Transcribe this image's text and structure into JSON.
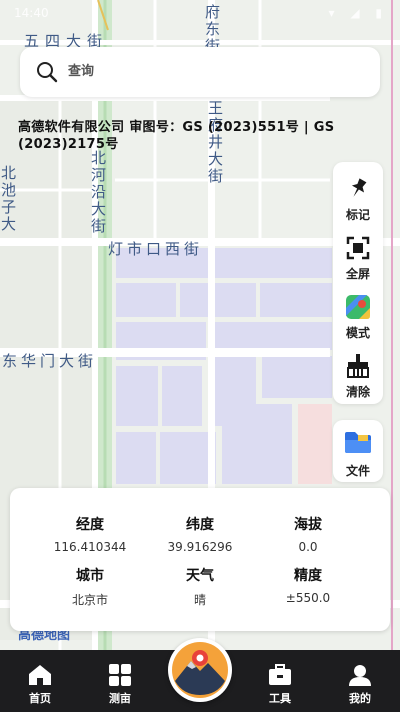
{
  "status_bar": {
    "time": "14:40",
    "system_icons": "▾ ◢ ▮"
  },
  "map": {
    "streets": [
      {
        "id": "wangfujing_east",
        "text": "府东街"
      },
      {
        "id": "wusi",
        "text": "五四大街"
      },
      {
        "id": "wangfujing",
        "text": "王府井大街"
      },
      {
        "id": "beiheyan",
        "text": "北河沿大街"
      },
      {
        "id": "dengshikou",
        "text": "灯市口西街"
      },
      {
        "id": "donghuamen",
        "text": "东华门大街"
      },
      {
        "id": "beichizi",
        "text": "北池子大"
      }
    ],
    "colors": {
      "park": "#cfe8cc",
      "block": "#dcdcf2",
      "hospital": "#f6dede",
      "road": "#ffffff"
    }
  },
  "search": {
    "label": "查询",
    "icon": "search-icon"
  },
  "approval_text": "高德软件有限公司 审图号：GS (2023)551号 | GS (2023)2175号",
  "tools": [
    {
      "id": "mark",
      "label": "标记",
      "icon": "pin-icon"
    },
    {
      "id": "fullscreen",
      "label": "全屏",
      "icon": "fullscreen-icon"
    },
    {
      "id": "mode",
      "label": "模式",
      "icon": "map-mode-icon"
    },
    {
      "id": "clear",
      "label": "清除",
      "icon": "broom-icon"
    }
  ],
  "file_button": {
    "label": "文件",
    "icon": "folder-icon"
  },
  "info": {
    "longitude": {
      "label": "经度",
      "value": "116.410344"
    },
    "latitude": {
      "label": "纬度",
      "value": "39.916296"
    },
    "altitude": {
      "label": "海拔",
      "value": "0.0"
    },
    "city": {
      "label": "城市",
      "value": "北京市"
    },
    "weather": {
      "label": "天气",
      "value": "晴"
    },
    "accuracy": {
      "label": "精度",
      "value": "±550.0"
    }
  },
  "watermark": "高德地图",
  "nav": [
    {
      "id": "home",
      "label": "首页",
      "icon": "home-icon"
    },
    {
      "id": "measure",
      "label": "测亩",
      "icon": "grid-icon"
    },
    {
      "id": "center",
      "label": "",
      "icon": "mountain-location-icon"
    },
    {
      "id": "tools",
      "label": "工具",
      "icon": "toolbox-icon"
    },
    {
      "id": "me",
      "label": "我的",
      "icon": "user-icon"
    }
  ]
}
